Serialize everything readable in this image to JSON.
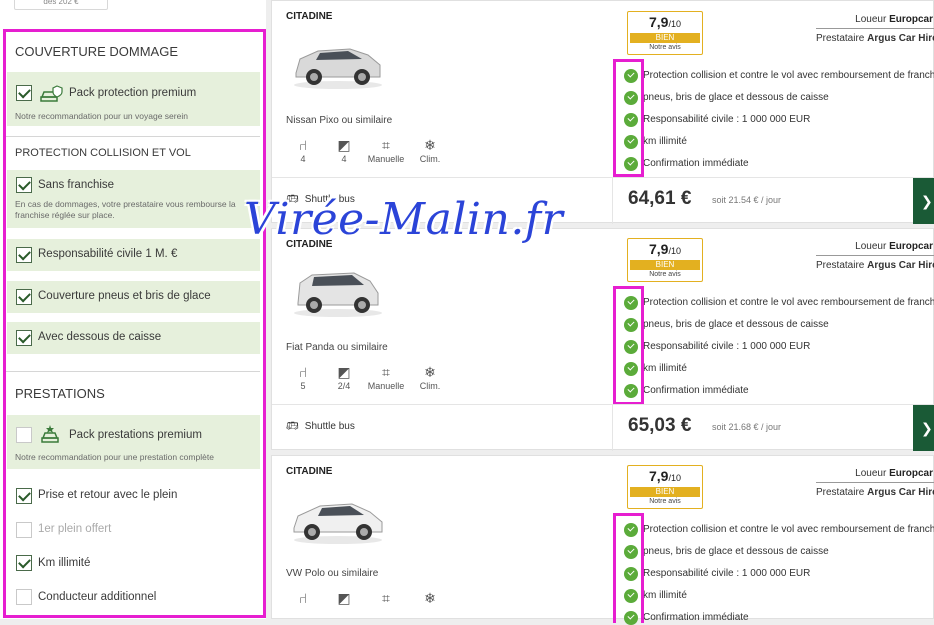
{
  "sidebar": {
    "top_pill": "dès 202 €",
    "sections": [
      {
        "title": "COUVERTURE DOMMAGE",
        "options": [
          {
            "label": "Pack protection premium",
            "checked": true,
            "icon": "car-shield-icon",
            "desc": "Notre recommandation pour un voyage serein"
          }
        ]
      },
      {
        "title": "PROTECTION COLLISION ET VOL",
        "options": [
          {
            "label": "Sans franchise",
            "checked": true,
            "desc": "En cas de dommages, votre prestataire vous rembourse la franchise réglée sur place."
          },
          {
            "label": "Responsabilité civile 1 M. €",
            "checked": true
          },
          {
            "label": "Couverture pneus et bris de glace",
            "checked": true
          },
          {
            "label": "Avec dessous de caisse",
            "checked": true
          }
        ]
      },
      {
        "title": "PRESTATIONS",
        "options": [
          {
            "label": "Pack prestations premium",
            "checked": false,
            "icon": "car-star-icon",
            "desc": "Notre recommandation pour une prestation complète"
          },
          {
            "label": "Prise et retour avec le plein",
            "checked": true
          },
          {
            "label": "1er plein offert",
            "checked": false,
            "disabled": true
          },
          {
            "label": "Km illimité",
            "checked": true
          },
          {
            "label": "Conducteur additionnel",
            "checked": false
          }
        ]
      }
    ]
  },
  "cards": [
    {
      "category": "CITADINE",
      "car_name": "Nissan Pixo ou similaire",
      "car_color": "#d9d9d9",
      "features": [
        {
          "icon": "seat-icon",
          "value": "4"
        },
        {
          "icon": "door-icon",
          "value": "4"
        },
        {
          "icon": "gearbox-icon",
          "value": "Manuelle"
        },
        {
          "icon": "snowflake-icon",
          "value": "Clim."
        }
      ],
      "rating": {
        "score": "7,9",
        "out_of": "/10",
        "band": "BIEN",
        "note": "Notre avis"
      },
      "loueur_label": "Loueur",
      "loueur": "Europcar",
      "prestataire_label": "Prestataire",
      "prestataire": "Argus Car Hire",
      "inclusions": [
        "Protection collision et contre le vol avec remboursement de franchise",
        "pneus, bris de glace et dessous de caisse",
        "Responsabilité civile : 1 000 000 EUR",
        "km illimité",
        "Confirmation immédiate"
      ],
      "shuttle": "Shuttle bus",
      "price": "64,61 €",
      "per_day": "soit 21.54 € / jour",
      "button": "❯"
    },
    {
      "category": "CITADINE",
      "car_name": "Fiat Panda ou similaire",
      "car_color": "#e4e4e4",
      "features": [
        {
          "icon": "seat-icon",
          "value": "5"
        },
        {
          "icon": "door-icon",
          "value": "2/4"
        },
        {
          "icon": "gearbox-icon",
          "value": "Manuelle"
        },
        {
          "icon": "snowflake-icon",
          "value": "Clim."
        }
      ],
      "rating": {
        "score": "7,9",
        "out_of": "/10",
        "band": "BIEN",
        "note": "Notre avis"
      },
      "loueur_label": "Loueur",
      "loueur": "Europcar",
      "prestataire_label": "Prestataire",
      "prestataire": "Argus Car Hire",
      "inclusions": [
        "Protection collision et contre le vol avec remboursement de franchise",
        "pneus, bris de glace et dessous de caisse",
        "Responsabilité civile : 1 000 000 EUR",
        "km illimité",
        "Confirmation immédiate"
      ],
      "shuttle": "Shuttle bus",
      "price": "65,03 €",
      "per_day": "soit 21.68 € / jour",
      "button": "❯"
    },
    {
      "category": "CITADINE",
      "car_name": "VW Polo ou similaire",
      "car_color": "#f0f0f0",
      "features": [
        {
          "icon": "seat-icon",
          "value": ""
        },
        {
          "icon": "door-icon",
          "value": ""
        },
        {
          "icon": "gearbox-icon",
          "value": ""
        },
        {
          "icon": "snowflake-icon",
          "value": ""
        }
      ],
      "rating": {
        "score": "7,9",
        "out_of": "/10",
        "band": "BIEN",
        "note": "Notre avis"
      },
      "loueur_label": "Loueur",
      "loueur": "Europcar",
      "prestataire_label": "Prestataire",
      "prestataire": "Argus Car Hire",
      "inclusions": [
        "Protection collision et contre le vol avec remboursement de franchise",
        "pneus, bris de glace et dessous de caisse",
        "Responsabilité civile : 1 000 000 EUR",
        "km illimité",
        "Confirmation immédiate"
      ]
    }
  ],
  "watermark": "Virée-Malin.fr",
  "colors": {
    "highlight": "#e61ed0",
    "option_bg": "#e6f0dc",
    "check_green": "#5bab3a",
    "rating_gold": "#e3b020",
    "cta_green": "#1a5a36",
    "watermark_blue": "#2b44d8"
  }
}
